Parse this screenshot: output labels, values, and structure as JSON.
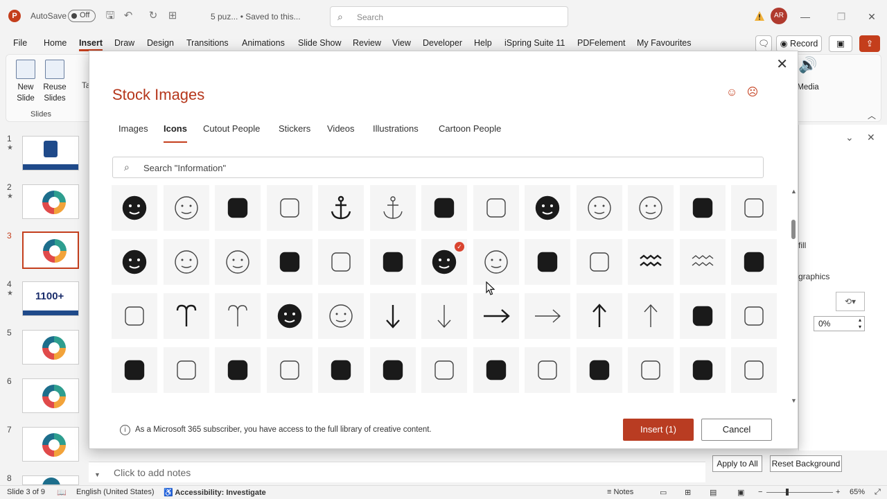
{
  "titlebar": {
    "autosave_label": "AutoSave",
    "autosave_state": "Off",
    "document_title": "5 puz... • Saved to this...",
    "search_placeholder": "Search",
    "user_initials": "AR"
  },
  "menu": {
    "items": [
      "File",
      "Home",
      "Insert",
      "Draw",
      "Design",
      "Transitions",
      "Animations",
      "Slide Show",
      "Review",
      "View",
      "Developer",
      "Help",
      "iSpring Suite 11",
      "PDFelement",
      "My Favourites"
    ],
    "active": "Insert",
    "record_label": "Record"
  },
  "ribbon": {
    "new_slide": "New Slide",
    "reuse_slides": "Reuse Slides",
    "slides_group": "Slides",
    "media": "Media",
    "ta_partial": "Ta"
  },
  "thumbnails": {
    "numbers": [
      "1",
      "2",
      "3",
      "4",
      "5",
      "6",
      "7",
      "8"
    ],
    "selected": "3",
    "slide4_label": "1100+"
  },
  "right_pane": {
    "fill": "fill",
    "graphics": "graphics",
    "transparency": "0%",
    "apply_all": "Apply to All",
    "reset_bg": "Reset Background"
  },
  "notes": {
    "placeholder": "Click to add notes"
  },
  "status": {
    "slide_of": "Slide 3 of 9",
    "language": "English (United States)",
    "accessibility": "Accessibility: Investigate",
    "notes": "Notes",
    "zoom": "65%"
  },
  "dialog": {
    "title": "Stock Images",
    "tabs": [
      "Images",
      "Icons",
      "Cutout People",
      "Stickers",
      "Videos",
      "Illustrations",
      "Cartoon People"
    ],
    "active_tab": "Icons",
    "search_placeholder": "Search \"Information\"",
    "info_text": "As a Microsoft 365 subscriber, you have access to the full library of creative content.",
    "insert_label": "Insert (1)",
    "cancel_label": "Cancel",
    "selected_icon": "shutter-filled",
    "icon_rows": [
      [
        "button-filled",
        "button-outline",
        "ambulance-filled",
        "ambulance-outline",
        "anchor-filled",
        "anchor-outline",
        "bee-hand-filled",
        "bee-hand-outline",
        "smile-face-filled",
        "smile-face-outline",
        "angel-face-outline",
        "angry-cross-filled",
        "angry-cross-outline"
      ],
      [
        "angry-face-filled",
        "sad-face-outline",
        "annoyed-face-outline",
        "ant-filled",
        "ant-outline",
        "antarctica-filled",
        "shutter-filled",
        "shutter-outline",
        "apple-filled",
        "apple-outline",
        "aquarius-filled",
        "aquarius-outline",
        "architect-drawing-filled"
      ],
      [
        "architect-drawing-outline",
        "aries-filled",
        "aries-outline",
        "refresh-arrows-filled",
        "refresh-arrows-outline",
        "arrow-down-filled",
        "arrow-down-outline",
        "arrow-right-filled",
        "arrow-right-outline",
        "arrow-up-filled",
        "arrow-up-outline",
        "ai-head-filled",
        "ai-head-outline"
      ],
      [
        "artist-female-filled",
        "artist-female-outline",
        "artist-male-filled",
        "artist-male-outline",
        "asia-map-filled",
        "pagoda-filled",
        "pagoda-outline",
        "shrine-gate-filled",
        "shrine-gate-outline",
        "climber-filled",
        "climber-outline",
        "jumper-filled",
        "jumper-outline"
      ]
    ]
  }
}
